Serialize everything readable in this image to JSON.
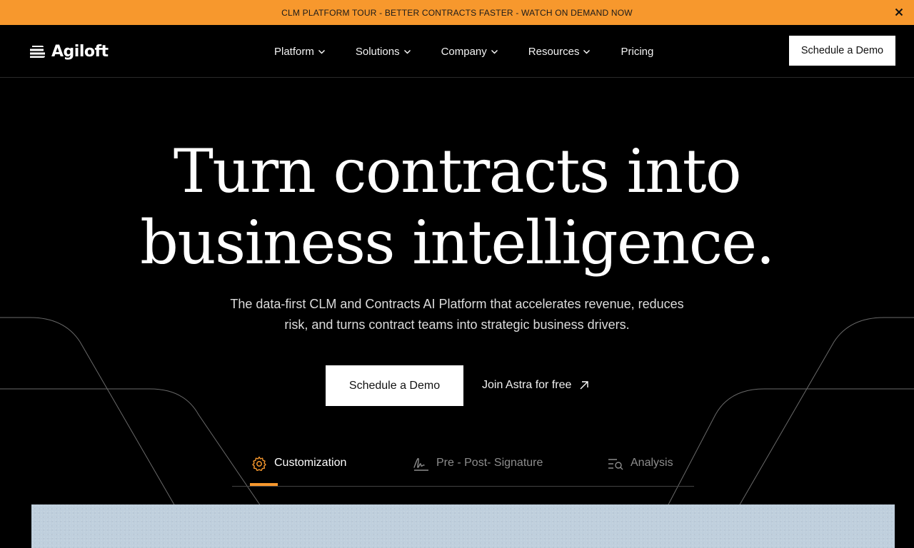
{
  "announcement": {
    "text": "CLM PLATFORM TOUR - BETTER CONTRACTS FASTER - WATCH ON DEMAND NOW",
    "close_icon": "close-icon"
  },
  "header": {
    "logo_text": "Agiloft",
    "nav": [
      {
        "label": "Platform",
        "has_dropdown": true
      },
      {
        "label": "Solutions",
        "has_dropdown": true
      },
      {
        "label": "Company",
        "has_dropdown": true
      },
      {
        "label": "Resources",
        "has_dropdown": true
      },
      {
        "label": "Pricing",
        "has_dropdown": false
      }
    ],
    "cta_label": "Schedule a Demo"
  },
  "hero": {
    "title_line1": "Turn contracts into",
    "title_line2": "business intelligence.",
    "subtitle_line1": "The data-first CLM and Contracts AI Platform that accelerates revenue, reduces",
    "subtitle_line2": "risk, and turns contract teams into strategic business drivers.",
    "primary_cta": "Schedule a Demo",
    "secondary_cta": "Join Astra for free",
    "secondary_icon": "arrow-up-right-icon"
  },
  "tabs": [
    {
      "label": "Customization",
      "icon": "gear-icon",
      "active": true
    },
    {
      "label": "Pre - Post- Signature",
      "icon": "signature-icon",
      "active": false
    },
    {
      "label": "Analysis",
      "icon": "analysis-icon",
      "active": false
    }
  ],
  "colors": {
    "accent": "#f7982d",
    "background": "#000000",
    "preview_panel": "#bfcfdd"
  }
}
